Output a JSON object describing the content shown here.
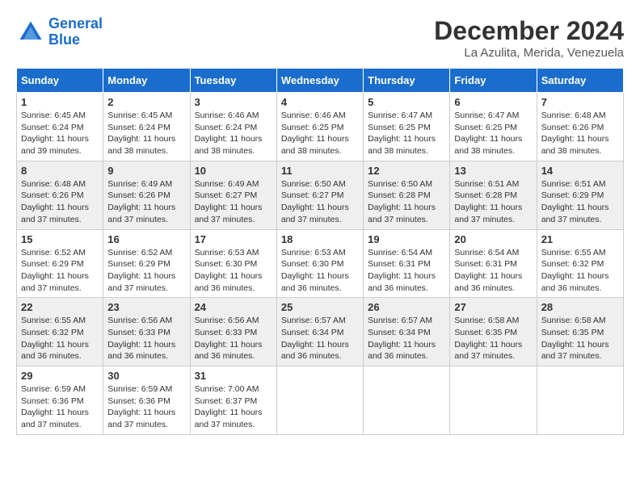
{
  "header": {
    "logo_line1": "General",
    "logo_line2": "Blue",
    "month_title": "December 2024",
    "location": "La Azulita, Merida, Venezuela"
  },
  "weekdays": [
    "Sunday",
    "Monday",
    "Tuesday",
    "Wednesday",
    "Thursday",
    "Friday",
    "Saturday"
  ],
  "weeks": [
    [
      {
        "day": "1",
        "sunrise": "6:45 AM",
        "sunset": "6:24 PM",
        "daylight": "11 hours and 39 minutes."
      },
      {
        "day": "2",
        "sunrise": "6:45 AM",
        "sunset": "6:24 PM",
        "daylight": "11 hours and 38 minutes."
      },
      {
        "day": "3",
        "sunrise": "6:46 AM",
        "sunset": "6:24 PM",
        "daylight": "11 hours and 38 minutes."
      },
      {
        "day": "4",
        "sunrise": "6:46 AM",
        "sunset": "6:25 PM",
        "daylight": "11 hours and 38 minutes."
      },
      {
        "day": "5",
        "sunrise": "6:47 AM",
        "sunset": "6:25 PM",
        "daylight": "11 hours and 38 minutes."
      },
      {
        "day": "6",
        "sunrise": "6:47 AM",
        "sunset": "6:25 PM",
        "daylight": "11 hours and 38 minutes."
      },
      {
        "day": "7",
        "sunrise": "6:48 AM",
        "sunset": "6:26 PM",
        "daylight": "11 hours and 38 minutes."
      }
    ],
    [
      {
        "day": "8",
        "sunrise": "6:48 AM",
        "sunset": "6:26 PM",
        "daylight": "11 hours and 37 minutes."
      },
      {
        "day": "9",
        "sunrise": "6:49 AM",
        "sunset": "6:26 PM",
        "daylight": "11 hours and 37 minutes."
      },
      {
        "day": "10",
        "sunrise": "6:49 AM",
        "sunset": "6:27 PM",
        "daylight": "11 hours and 37 minutes."
      },
      {
        "day": "11",
        "sunrise": "6:50 AM",
        "sunset": "6:27 PM",
        "daylight": "11 hours and 37 minutes."
      },
      {
        "day": "12",
        "sunrise": "6:50 AM",
        "sunset": "6:28 PM",
        "daylight": "11 hours and 37 minutes."
      },
      {
        "day": "13",
        "sunrise": "6:51 AM",
        "sunset": "6:28 PM",
        "daylight": "11 hours and 37 minutes."
      },
      {
        "day": "14",
        "sunrise": "6:51 AM",
        "sunset": "6:29 PM",
        "daylight": "11 hours and 37 minutes."
      }
    ],
    [
      {
        "day": "15",
        "sunrise": "6:52 AM",
        "sunset": "6:29 PM",
        "daylight": "11 hours and 37 minutes."
      },
      {
        "day": "16",
        "sunrise": "6:52 AM",
        "sunset": "6:29 PM",
        "daylight": "11 hours and 37 minutes."
      },
      {
        "day": "17",
        "sunrise": "6:53 AM",
        "sunset": "6:30 PM",
        "daylight": "11 hours and 36 minutes."
      },
      {
        "day": "18",
        "sunrise": "6:53 AM",
        "sunset": "6:30 PM",
        "daylight": "11 hours and 36 minutes."
      },
      {
        "day": "19",
        "sunrise": "6:54 AM",
        "sunset": "6:31 PM",
        "daylight": "11 hours and 36 minutes."
      },
      {
        "day": "20",
        "sunrise": "6:54 AM",
        "sunset": "6:31 PM",
        "daylight": "11 hours and 36 minutes."
      },
      {
        "day": "21",
        "sunrise": "6:55 AM",
        "sunset": "6:32 PM",
        "daylight": "11 hours and 36 minutes."
      }
    ],
    [
      {
        "day": "22",
        "sunrise": "6:55 AM",
        "sunset": "6:32 PM",
        "daylight": "11 hours and 36 minutes."
      },
      {
        "day": "23",
        "sunrise": "6:56 AM",
        "sunset": "6:33 PM",
        "daylight": "11 hours and 36 minutes."
      },
      {
        "day": "24",
        "sunrise": "6:56 AM",
        "sunset": "6:33 PM",
        "daylight": "11 hours and 36 minutes."
      },
      {
        "day": "25",
        "sunrise": "6:57 AM",
        "sunset": "6:34 PM",
        "daylight": "11 hours and 36 minutes."
      },
      {
        "day": "26",
        "sunrise": "6:57 AM",
        "sunset": "6:34 PM",
        "daylight": "11 hours and 36 minutes."
      },
      {
        "day": "27",
        "sunrise": "6:58 AM",
        "sunset": "6:35 PM",
        "daylight": "11 hours and 37 minutes."
      },
      {
        "day": "28",
        "sunrise": "6:58 AM",
        "sunset": "6:35 PM",
        "daylight": "11 hours and 37 minutes."
      }
    ],
    [
      {
        "day": "29",
        "sunrise": "6:59 AM",
        "sunset": "6:36 PM",
        "daylight": "11 hours and 37 minutes."
      },
      {
        "day": "30",
        "sunrise": "6:59 AM",
        "sunset": "6:36 PM",
        "daylight": "11 hours and 37 minutes."
      },
      {
        "day": "31",
        "sunrise": "7:00 AM",
        "sunset": "6:37 PM",
        "daylight": "11 hours and 37 minutes."
      },
      null,
      null,
      null,
      null
    ]
  ]
}
